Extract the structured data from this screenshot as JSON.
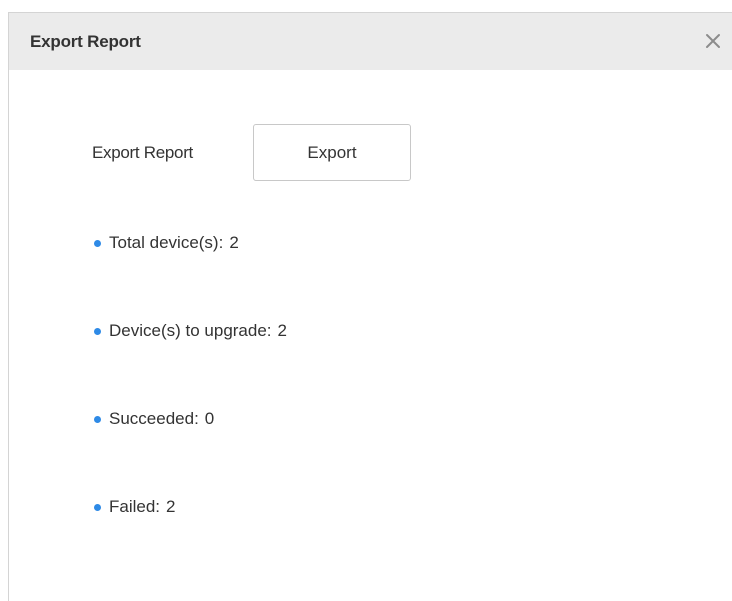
{
  "dialog": {
    "title": "Export Report",
    "close_icon": "close-icon"
  },
  "export": {
    "label": "Export Report",
    "button_label": "Export"
  },
  "stats": [
    {
      "label": "Total device(s):",
      "value": "2"
    },
    {
      "label": "Device(s) to upgrade:",
      "value": "2"
    },
    {
      "label": "Succeeded:",
      "value": "0"
    },
    {
      "label": "Failed:",
      "value": "2"
    }
  ],
  "colors": {
    "header_bg": "#ebebeb",
    "bullet": "#2e8ae6",
    "text": "#333333",
    "close_icon": "#8c8c8c"
  }
}
